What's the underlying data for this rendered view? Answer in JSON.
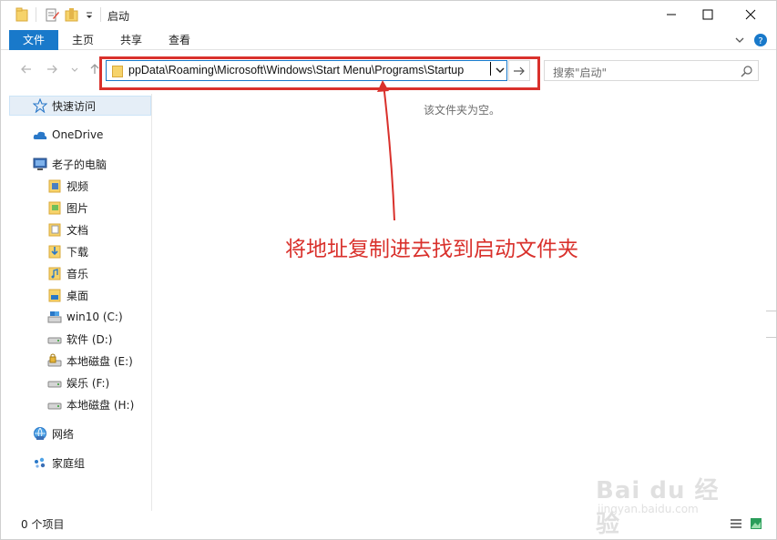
{
  "window": {
    "title": "启动"
  },
  "ribbon": {
    "tabs": [
      "文件",
      "主页",
      "共享",
      "查看"
    ]
  },
  "address": {
    "path": "ppData\\Roaming\\Microsoft\\Windows\\Start Menu\\Programs\\Startup"
  },
  "search": {
    "placeholder": "搜索\"启动\""
  },
  "sidebar": {
    "items": [
      {
        "label": "快速访问",
        "icon": "star-icon"
      },
      {
        "label": "OneDrive",
        "icon": "cloud-icon"
      },
      {
        "label": "老子的电脑",
        "icon": "computer-icon"
      },
      {
        "label": "视频",
        "icon": "video-folder-icon"
      },
      {
        "label": "图片",
        "icon": "picture-folder-icon"
      },
      {
        "label": "文档",
        "icon": "document-folder-icon"
      },
      {
        "label": "下载",
        "icon": "download-folder-icon"
      },
      {
        "label": "音乐",
        "icon": "music-folder-icon"
      },
      {
        "label": "桌面",
        "icon": "desktop-folder-icon"
      },
      {
        "label": "win10 (C:)",
        "icon": "system-drive-icon"
      },
      {
        "label": "软件 (D:)",
        "icon": "drive-icon"
      },
      {
        "label": "本地磁盘 (E:)",
        "icon": "locked-drive-icon"
      },
      {
        "label": "娱乐 (F:)",
        "icon": "drive-icon"
      },
      {
        "label": "本地磁盘 (H:)",
        "icon": "drive-icon"
      },
      {
        "label": "网络",
        "icon": "network-icon"
      },
      {
        "label": "家庭组",
        "icon": "homegroup-icon"
      }
    ]
  },
  "main": {
    "empty_message": "该文件夹为空。"
  },
  "annotation": {
    "text": "将地址复制进去找到启动文件夹",
    "color": "#d9312c"
  },
  "status": {
    "count": "0 个项目"
  },
  "watermark": {
    "brand": "Bai du 经验",
    "url": "jingyan.baidu.com"
  },
  "colors": {
    "accent": "#1979ca",
    "highlight": "#d9312c"
  }
}
